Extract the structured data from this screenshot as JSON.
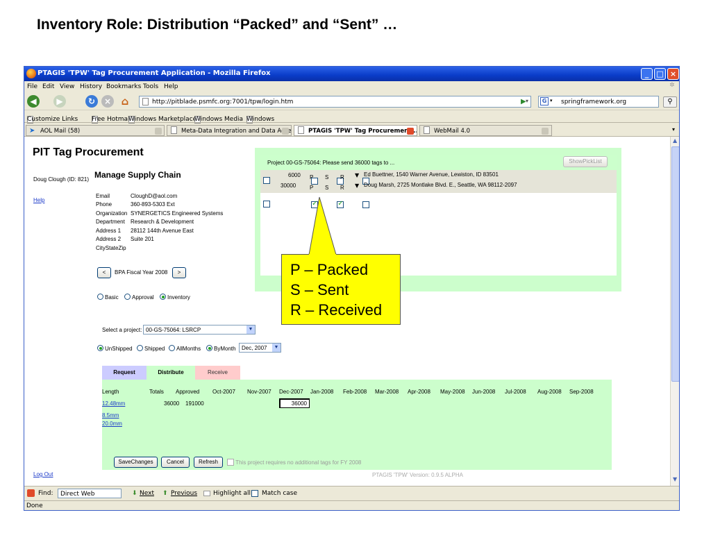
{
  "slide": {
    "title": "Inventory Role: Distribution “Packed” and “Sent” …"
  },
  "window": {
    "title": "PTAGIS 'TPW' Tag Procurement Application - Mozilla Firefox"
  },
  "menu": [
    "File",
    "Edit",
    "View",
    "History",
    "Bookmarks",
    "Tools",
    "Help"
  ],
  "nav": {
    "url": "http://pitblade.psmfc.org:7001/tpw/login.htm",
    "search_value": "springframework.org"
  },
  "bookmarks": [
    "Customize Links",
    "Free Hotmail",
    "Windows Marketplace",
    "Windows Media",
    "Windows"
  ],
  "tabs": [
    {
      "label": "AOL Mail (58)"
    },
    {
      "label": "Meta-Data Integration and Data Acce..."
    },
    {
      "label": "PTAGIS 'TPW' Tag Procurement ..."
    },
    {
      "label": "WebMail 4.0"
    }
  ],
  "app": {
    "heading": "PIT Tag Procurement",
    "user": "Doug Clough (ID: 821)",
    "help": "Help",
    "logout": "Log Out",
    "section_title": "Manage Supply Chain",
    "profile": [
      {
        "label": "Email",
        "value": "CloughD@aol.com"
      },
      {
        "label": "Phone",
        "value": "360-893-5303 Ext"
      },
      {
        "label": "Organization",
        "value": "SYNERGETICS Engineered Systems"
      },
      {
        "label": "Department",
        "value": "Research & Development"
      },
      {
        "label": "Address 1",
        "value": "28112 144th Avenue East"
      },
      {
        "label": "Address 2",
        "value": "Suite 201"
      },
      {
        "label": "CityStateZip",
        "value": ""
      }
    ],
    "fiscal": {
      "prev": "<",
      "label": "BPA Fiscal Year 2008",
      "next": ">"
    },
    "roles": [
      "Basic",
      "Approval",
      "Inventory"
    ],
    "project_label": "Select a project:",
    "project_value": "00-GS-75064: LSRCP",
    "filters": [
      "UnShipped",
      "Shipped",
      "AllMonths",
      "ByMonth"
    ],
    "month_value": "Dec, 2007",
    "section_tabs": [
      "Request",
      "Distribute",
      "Receive"
    ],
    "grid": {
      "headers": [
        "Length",
        "Totals",
        "Approved",
        "Oct-2007",
        "Nov-2007",
        "Dec-2007",
        "Jan-2008",
        "Feb-2008",
        "Mar-2008",
        "Apr-2008",
        "May-2008",
        "Jun-2008",
        "Jul-2008",
        "Aug-2008",
        "Sep-2008"
      ],
      "lengths": [
        "12.48mm",
        "8.5mm",
        "20.0mm"
      ],
      "row1_totals": "36000",
      "row1_approved": "191000",
      "dec_value": "36000"
    },
    "buttons": {
      "save": "SaveChanges",
      "cancel": "Cancel",
      "refresh": "Refresh"
    },
    "no_tags_text": "This project requires no additional tags for FY 2008",
    "version": "PTAGIS 'TPW' Version: 0.9.5 ALPHA"
  },
  "popup": {
    "header": "Project 00-GS-75064: Please send 36000 tags to ...",
    "button": "ShowPickList",
    "rows": [
      {
        "qty": "6000",
        "p": false,
        "s": false,
        "r": false,
        "addr": "Ed Buettner, 1540 Warner Avenue, Lewiston, ID 83501"
      },
      {
        "qty": "30000",
        "p": true,
        "s": true,
        "r": false,
        "addr": "Doug Marsh, 2725 Montlake Blvd. E., Seattle, WA 98112-2097"
      }
    ],
    "flag_labels": {
      "p": "P",
      "s": "S",
      "r": "R"
    }
  },
  "callout": {
    "lines": [
      "P – Packed",
      "S – Sent",
      "R – Received"
    ]
  },
  "find": {
    "label": "Find:",
    "value": "Direct Web",
    "next": "Next",
    "previous": "Previous",
    "highlight": "Highlight all",
    "match": "Match case"
  },
  "status": "Done"
}
